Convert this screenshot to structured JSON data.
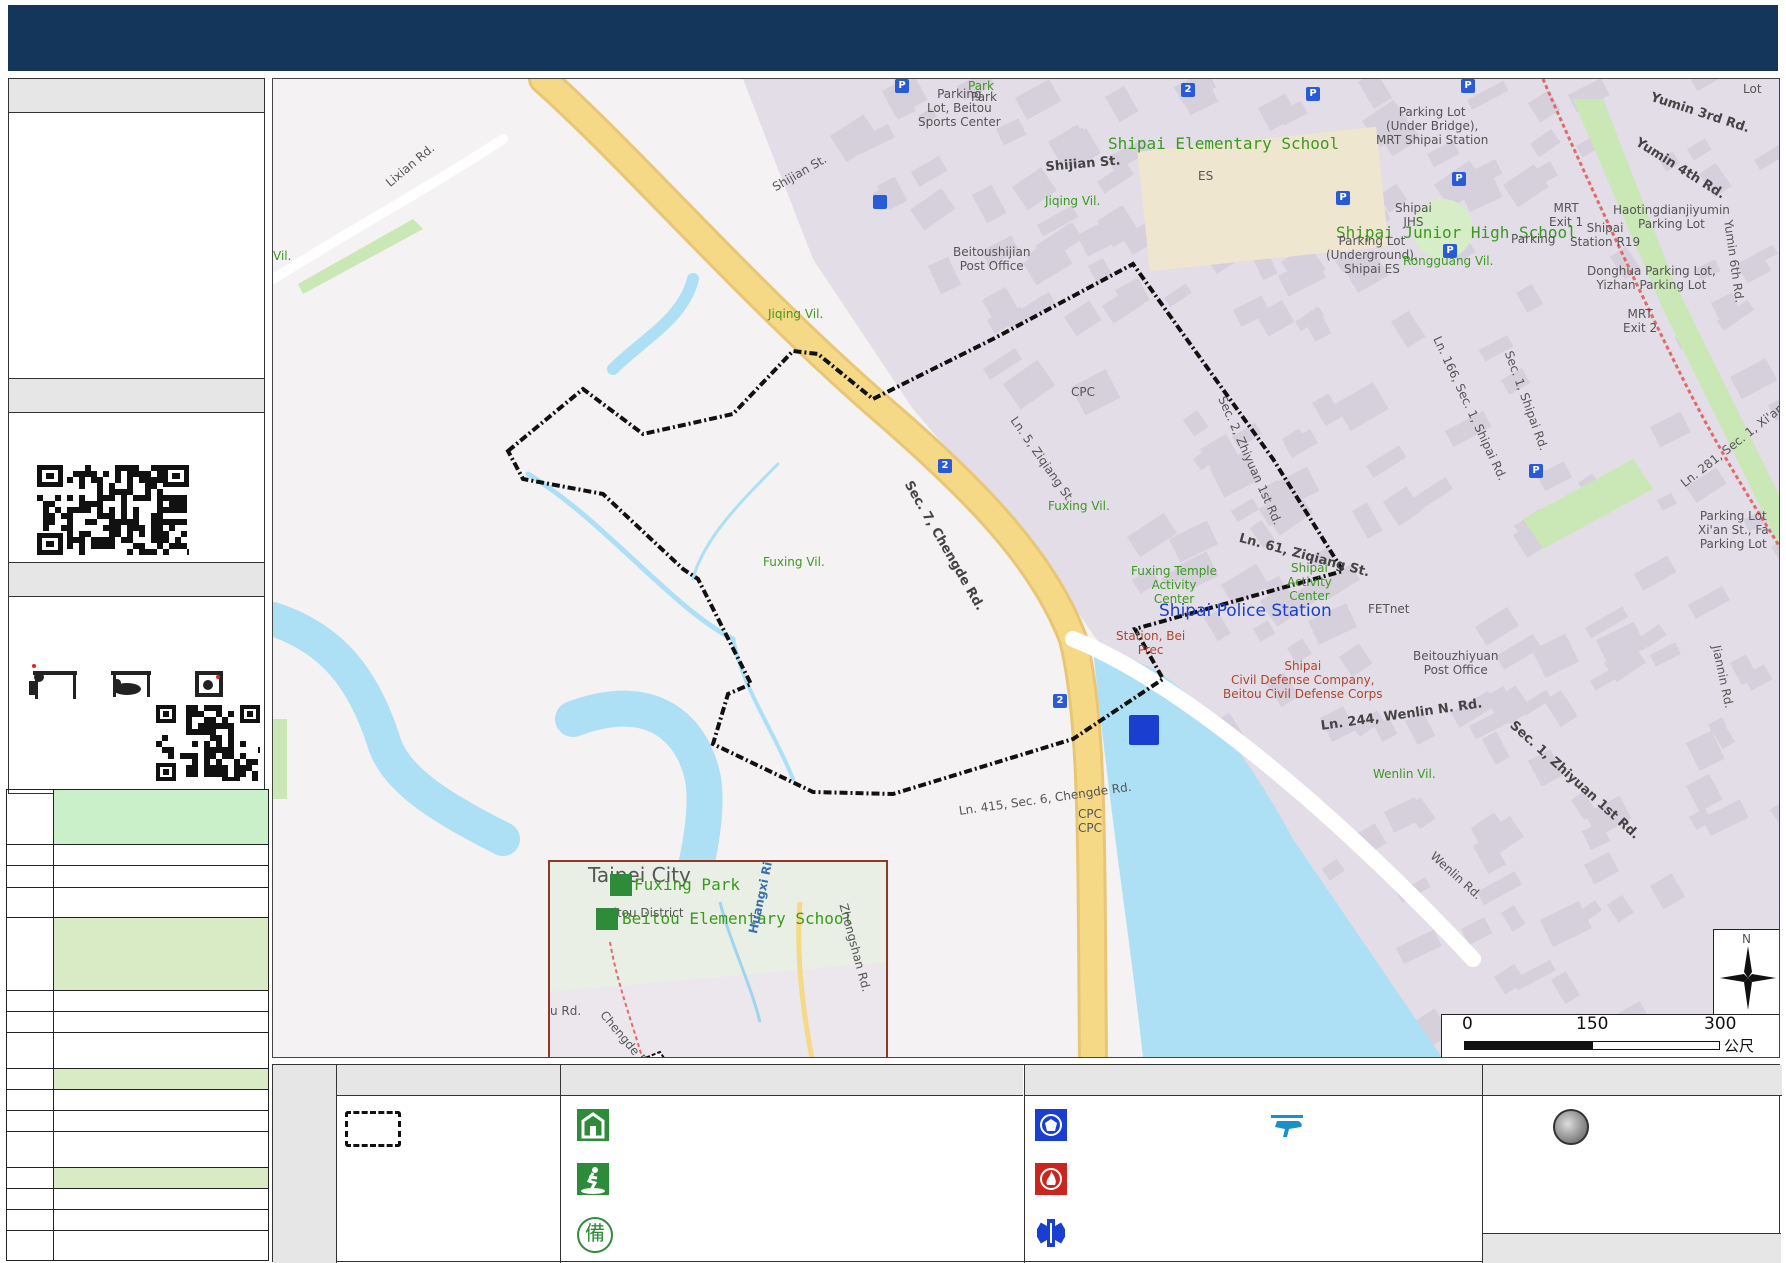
{
  "map": {
    "places": [
      {
        "text": "Parking\nLot, Beitou\nSports Center",
        "cls": ""
      },
      {
        "text": "Park",
        "cls": "g"
      },
      {
        "text": "Shipai Elementary School",
        "cls": "g big"
      },
      {
        "text": "ES",
        "cls": ""
      },
      {
        "text": "Shijian St.",
        "cls": "road"
      },
      {
        "text": "Jiqing Vil.",
        "cls": "g"
      },
      {
        "text": "Beitoushijian\nPost Office",
        "cls": ""
      },
      {
        "text": "Shijian St.",
        "cls": ""
      },
      {
        "text": "Lixian Rd.",
        "cls": ""
      },
      {
        "text": "Vil.",
        "cls": "g"
      },
      {
        "text": "Jiqing Vil.",
        "cls": "g"
      },
      {
        "text": "Parking Lot\n(Under Bridge),\nMRT Shipai Station",
        "cls": ""
      },
      {
        "text": "Yumin 3rd Rd.",
        "cls": "road"
      },
      {
        "text": "Yumin 4th Rd.",
        "cls": "road"
      },
      {
        "text": "Haotingdianjiyumin\nParking Lot",
        "cls": ""
      },
      {
        "text": "Shipai\nJHS",
        "cls": ""
      },
      {
        "text": "MRT\nExit 1",
        "cls": ""
      },
      {
        "text": "Shipai Junior High School",
        "cls": "g big"
      },
      {
        "text": "Parking",
        "cls": ""
      },
      {
        "text": "Parking Lot\n(Underground),\nShipai ES",
        "cls": ""
      },
      {
        "text": "Rongguang Vil.",
        "cls": "g"
      },
      {
        "text": "Shipai\nStation R19",
        "cls": ""
      },
      {
        "text": "Donghua Parking Lot,\nYizhan Parking Lot",
        "cls": ""
      },
      {
        "text": "MRT\nExit 2",
        "cls": ""
      },
      {
        "text": "Yumin 6th Rd.",
        "cls": ""
      },
      {
        "text": "Sec. 1, Shipai Rd.",
        "cls": ""
      },
      {
        "text": "CPC",
        "cls": ""
      },
      {
        "text": "Sec. 7, Chengde Rd.",
        "cls": "road"
      },
      {
        "text": "Ln. 5, Ziqiang St.",
        "cls": ""
      },
      {
        "text": "Sec. 2, Zhiyuan 1st Rd.",
        "cls": ""
      },
      {
        "text": "Ln. 166, Sec. 1, Shipai Rd.",
        "cls": ""
      },
      {
        "text": "Fuxing Vil.",
        "cls": "g"
      },
      {
        "text": "Fuxing Vil.",
        "cls": "g"
      },
      {
        "text": "Ln. 281, Sec. 1, Xi'an St.",
        "cls": ""
      },
      {
        "text": "Parking Lot\nXi'an St., Fa\nParking Lot",
        "cls": ""
      },
      {
        "text": "Ln. 61, Ziqiang St.",
        "cls": "road"
      },
      {
        "text": "Fuxing Temple\nActivity\nCenter",
        "cls": "g"
      },
      {
        "text": "Shipai\nActivity\nCenter",
        "cls": "g"
      },
      {
        "text": "FETnet",
        "cls": ""
      },
      {
        "text": "Shipai Police Station",
        "cls": "blue"
      },
      {
        "text": "Station, Bei\nPrec",
        "cls": "red"
      },
      {
        "text": "Shipai\nCivil Defense Company,\nBeitou Civil Defense Corps",
        "cls": "red"
      },
      {
        "text": "Beitouzhiyuan\nPost Office",
        "cls": ""
      },
      {
        "text": "Ln. 244, Wenlin N. Rd.",
        "cls": "road"
      },
      {
        "text": "Sec. 1, Zhiyuan 1st Rd.",
        "cls": "road"
      },
      {
        "text": "Jiannin Rd.",
        "cls": ""
      },
      {
        "text": "Wenlin Vil.",
        "cls": "g"
      },
      {
        "text": "Ln. 415, Sec. 6, Chengde Rd.",
        "cls": ""
      },
      {
        "text": "CPC\nCPC",
        "cls": ""
      },
      {
        "text": "Wenlin Rd.",
        "cls": ""
      },
      {
        "text": "Lot",
        "cls": ""
      },
      {
        "text": "Park",
        "cls": ""
      }
    ],
    "parking_icon": "P",
    "highway_shield": "2"
  },
  "inset": {
    "city": "Taipei City",
    "district": "Beitou District",
    "park": "Fuxing Park",
    "school": "Beitou Elementary School",
    "river": "Huangxi River",
    "road1": "Chengde Rd.",
    "road2": "Zhongshan Rd.",
    "road3": "u Rd."
  },
  "scale": {
    "ticks": [
      "0",
      "150",
      "300"
    ],
    "unit": "公尺"
  },
  "compass": {
    "north": "N"
  },
  "legend": {
    "icons": [
      "dashed-boundary-icon",
      "shelter-school-icon",
      "evacuation-park-icon",
      "reserve-supplies-icon",
      "police-station-icon",
      "fire-station-icon",
      "medical-icon",
      "helicopter-icon",
      "circle-marker-icon"
    ],
    "colors": {
      "school": "#2e8b3a",
      "police": "#1a3fd0",
      "fire": "#c8261e",
      "medical": "#1a3fd0",
      "heli": "#1a8fc8"
    }
  },
  "colors": {
    "banner": "#14365a",
    "river": "#aee0f5",
    "highway": "#f5d987",
    "blocks": "#dcd6e0",
    "green": "#c9e8b5"
  }
}
